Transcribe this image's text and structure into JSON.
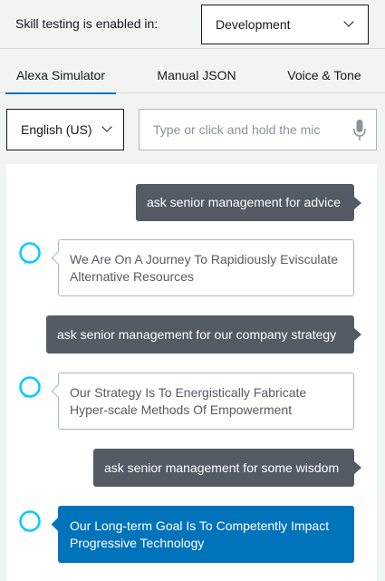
{
  "header": {
    "label": "Skill testing is enabled in:",
    "environment": "Development"
  },
  "tabs": [
    {
      "label": "Alexa Simulator",
      "active": true
    },
    {
      "label": "Manual JSON",
      "active": false
    },
    {
      "label": "Voice & Tone",
      "active": false
    }
  ],
  "input_row": {
    "locale": "English (US)",
    "placeholder": "Type or click and hold the mic"
  },
  "colors": {
    "accent": "#0073bb",
    "user_bubble": "#545b64",
    "alexa_ring": "#00caff"
  },
  "conversation": [
    {
      "role": "user",
      "text": "ask senior management for advice"
    },
    {
      "role": "alexa",
      "text": "We Are On A Journey To Rapidiously Evisculate Alternative Resources"
    },
    {
      "role": "user",
      "text": "ask senior management for our company strategy"
    },
    {
      "role": "alexa",
      "text": "Our Strategy Is To Energistically Fabricate Hyper-scale Methods Of Empowerment"
    },
    {
      "role": "user",
      "text": "ask senior management for some wisdom"
    },
    {
      "role": "alexa",
      "text": "Our Long-term Goal Is To Competently Impact Progressive Technology",
      "highlighted": true
    }
  ]
}
